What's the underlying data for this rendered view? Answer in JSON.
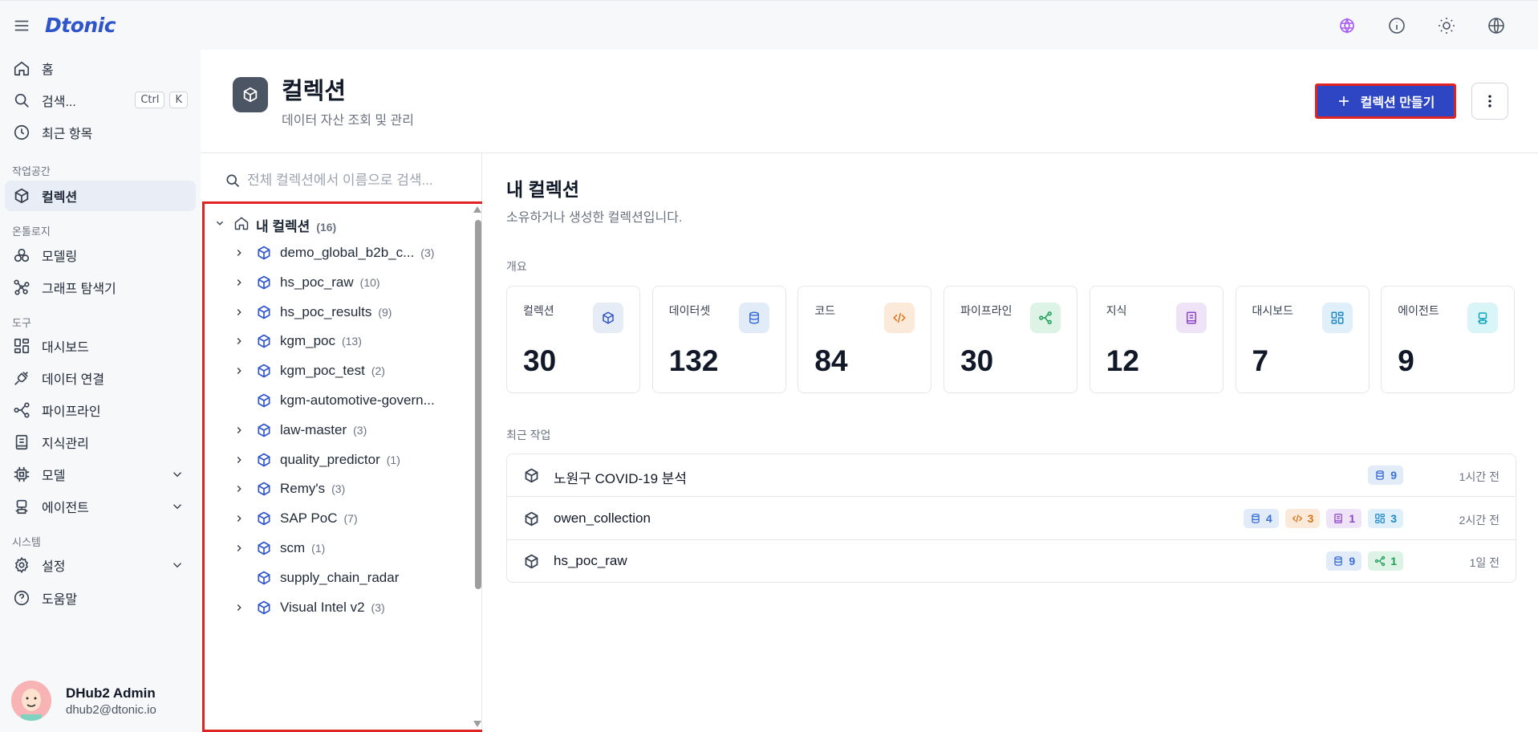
{
  "app": {
    "logo": "Dtonic"
  },
  "sidebar": {
    "home": "홈",
    "search": "검색...",
    "kbd_ctrl": "Ctrl",
    "kbd_k": "K",
    "recent": "최근 항목",
    "sec_workspace": "작업공간",
    "collections": "컬렉션",
    "sec_ontology": "온톨로지",
    "modeling": "모델링",
    "graph_explorer": "그래프 탐색기",
    "sec_tools": "도구",
    "dashboard": "대시보드",
    "data_connection": "데이터 연결",
    "pipeline": "파이프라인",
    "knowledge": "지식관리",
    "model": "모델",
    "agent": "에이전트",
    "sec_system": "시스템",
    "settings": "설정",
    "help": "도움말",
    "user_name": "DHub2 Admin",
    "user_email": "dhub2@dtonic.io"
  },
  "header": {
    "title": "컬렉션",
    "subtitle": "데이터 자산 조회 및 관리",
    "create_label": "컬렉션 만들기"
  },
  "tree": {
    "search_placeholder": "전체 컬렉션에서 이름으로 검색...",
    "root_label": "내 컬렉션",
    "root_count": "(16)",
    "items": [
      {
        "label": "demo_global_b2b_c...",
        "count": "(3)",
        "expandable": true
      },
      {
        "label": "hs_poc_raw",
        "count": "(10)",
        "expandable": true
      },
      {
        "label": "hs_poc_results",
        "count": "(9)",
        "expandable": true
      },
      {
        "label": "kgm_poc",
        "count": "(13)",
        "expandable": true
      },
      {
        "label": "kgm_poc_test",
        "count": "(2)",
        "expandable": true
      },
      {
        "label": "kgm-automotive-govern...",
        "count": "",
        "expandable": false
      },
      {
        "label": "law-master",
        "count": "(3)",
        "expandable": true
      },
      {
        "label": "quality_predictor",
        "count": "(1)",
        "expandable": true
      },
      {
        "label": "Remy's",
        "count": "(3)",
        "expandable": true
      },
      {
        "label": "SAP PoC",
        "count": "(7)",
        "expandable": true
      },
      {
        "label": "scm",
        "count": "(1)",
        "expandable": true
      },
      {
        "label": "supply_chain_radar",
        "count": "",
        "expandable": false
      },
      {
        "label": "Visual Intel v2",
        "count": "(3)",
        "expandable": true
      }
    ]
  },
  "main": {
    "title": "내 컬렉션",
    "subtitle": "소유하거나 생성한 컬렉션입니다.",
    "overview_label": "개요",
    "recent_label": "최근 작업",
    "stats": [
      {
        "label": "컬렉션",
        "value": "30",
        "icon": "cube-icon",
        "bg": "#e6ecf5",
        "fg": "#2f55c9"
      },
      {
        "label": "데이터셋",
        "value": "132",
        "icon": "database-icon",
        "bg": "#e2ebf8",
        "fg": "#3b6fd8"
      },
      {
        "label": "코드",
        "value": "84",
        "icon": "code-icon",
        "bg": "#fbe9d9",
        "fg": "#d9731a"
      },
      {
        "label": "파이프라인",
        "value": "30",
        "icon": "pipeline-icon",
        "bg": "#dcf3e6",
        "fg": "#1f9d57"
      },
      {
        "label": "지식",
        "value": "12",
        "icon": "book-icon",
        "bg": "#eee3f7",
        "fg": "#8e44c8"
      },
      {
        "label": "대시보드",
        "value": "7",
        "icon": "dashboard-icon",
        "bg": "#e0f0fa",
        "fg": "#1e88c7"
      },
      {
        "label": "에이전트",
        "value": "9",
        "icon": "agent-icon",
        "bg": "#d9f5f8",
        "fg": "#13a3b8"
      }
    ],
    "recent": [
      {
        "name": "노원구 COVID-19 분석",
        "time": "1시간 전",
        "chips": [
          {
            "type": "database",
            "value": "9"
          }
        ]
      },
      {
        "name": "owen_collection",
        "time": "2시간 전",
        "chips": [
          {
            "type": "database",
            "value": "4"
          },
          {
            "type": "code",
            "value": "3"
          },
          {
            "type": "book",
            "value": "1"
          },
          {
            "type": "dashboard",
            "value": "3"
          }
        ]
      },
      {
        "name": "hs_poc_raw",
        "time": "1일 전",
        "chips": [
          {
            "type": "database",
            "value": "9"
          },
          {
            "type": "pipeline",
            "value": "1"
          }
        ]
      }
    ]
  },
  "colors": {
    "accent": "#2e46c4",
    "highlight_border": "#e02424",
    "chip_database_bg": "#e2ebf8",
    "chip_database_fg": "#3b6fd8",
    "chip_code_bg": "#fbe9d9",
    "chip_code_fg": "#d9731a",
    "chip_book_bg": "#eee3f7",
    "chip_book_fg": "#8e44c8",
    "chip_dashboard_bg": "#e0f0fa",
    "chip_dashboard_fg": "#1e88c7",
    "chip_pipeline_bg": "#dcf3e6",
    "chip_pipeline_fg": "#1f9d57"
  }
}
